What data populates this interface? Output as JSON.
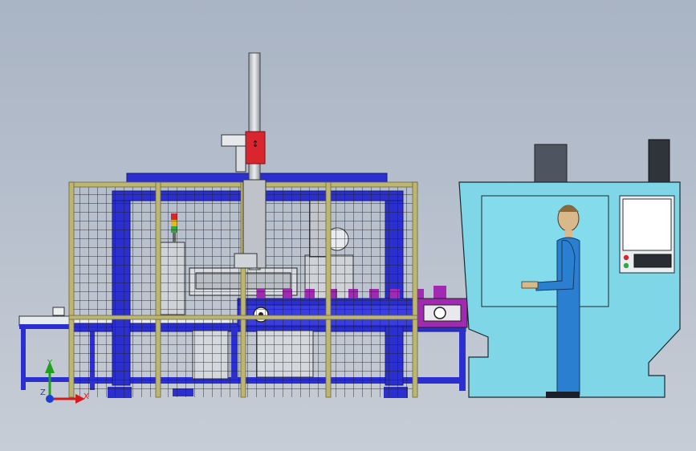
{
  "viewport": {
    "background_top": "#a9b4c4",
    "background_bottom": "#c7cdd6"
  },
  "colors": {
    "frame_blue": "#2b2fd0",
    "frame_dark": "#1a1d8a",
    "fence_frame": "#b8b070",
    "fence_mesh": "#222222",
    "gantry_red": "#d9262e",
    "gantry_silver": "#c8cbd0",
    "part_magenta": "#a02ab0",
    "cabinet_cyan": "#7fd6e6",
    "operator_blue": "#2a7fd0",
    "operator_head": "#d9b98a",
    "hmi_screen": "#ffffff",
    "axis_y": "#1fa11f",
    "axis_x": "#d41c1c",
    "axis_z": "#1c3fd4"
  },
  "triad": {
    "x_label": "X",
    "y_label": "Y",
    "z_label": "Z"
  }
}
